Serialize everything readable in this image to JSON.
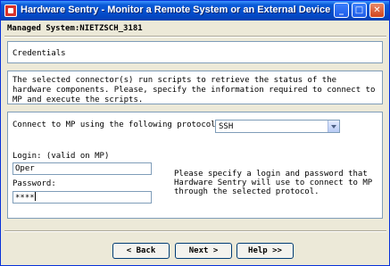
{
  "window": {
    "title": "Hardware Sentry - Monitor a Remote System or an External Device",
    "minimize_glyph": "_",
    "maximize_glyph": "□",
    "close_glyph": "✕"
  },
  "managed_system": "Managed System:NIETZSCH_3181",
  "credentials": {
    "heading": "Credentials"
  },
  "info": {
    "text": "The selected connector(s) run scripts to retrieve the status of the hardware components. Please, specify the information required to connect to MP and execute the scripts."
  },
  "form": {
    "protocol_label": "Connect to MP using the following protocol:",
    "protocol_value": "SSH",
    "login_label": "Login: (valid on MP)",
    "login_value": "Oper",
    "password_label": "Password:",
    "password_value": "****",
    "help_text": "Please specify a login and password that Hardware Sentry will use to connect to MP through the selected protocol."
  },
  "buttons": {
    "back": "< Back",
    "next": "Next >",
    "help": "Help >>"
  }
}
